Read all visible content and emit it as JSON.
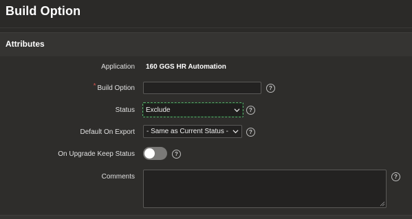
{
  "page": {
    "title": "Build Option"
  },
  "region": {
    "title": "Attributes"
  },
  "form": {
    "application": {
      "label": "Application",
      "value": "160 GGS HR Automation"
    },
    "build_option": {
      "label": "Build Option",
      "required_marker": "*",
      "value": ""
    },
    "status": {
      "label": "Status",
      "selected": "Exclude"
    },
    "default_on_export": {
      "label": "Default On Export",
      "selected": "- Same as Current Status -"
    },
    "on_upgrade_keep_status": {
      "label": "On Upgrade Keep Status",
      "checked": false
    },
    "comments": {
      "label": "Comments",
      "value": ""
    }
  },
  "help_icon_glyph": "?",
  "colors": {
    "background": "#2b2a28",
    "region_header": "#353432",
    "focus_border": "#5aa86a",
    "required": "#d9534f"
  }
}
